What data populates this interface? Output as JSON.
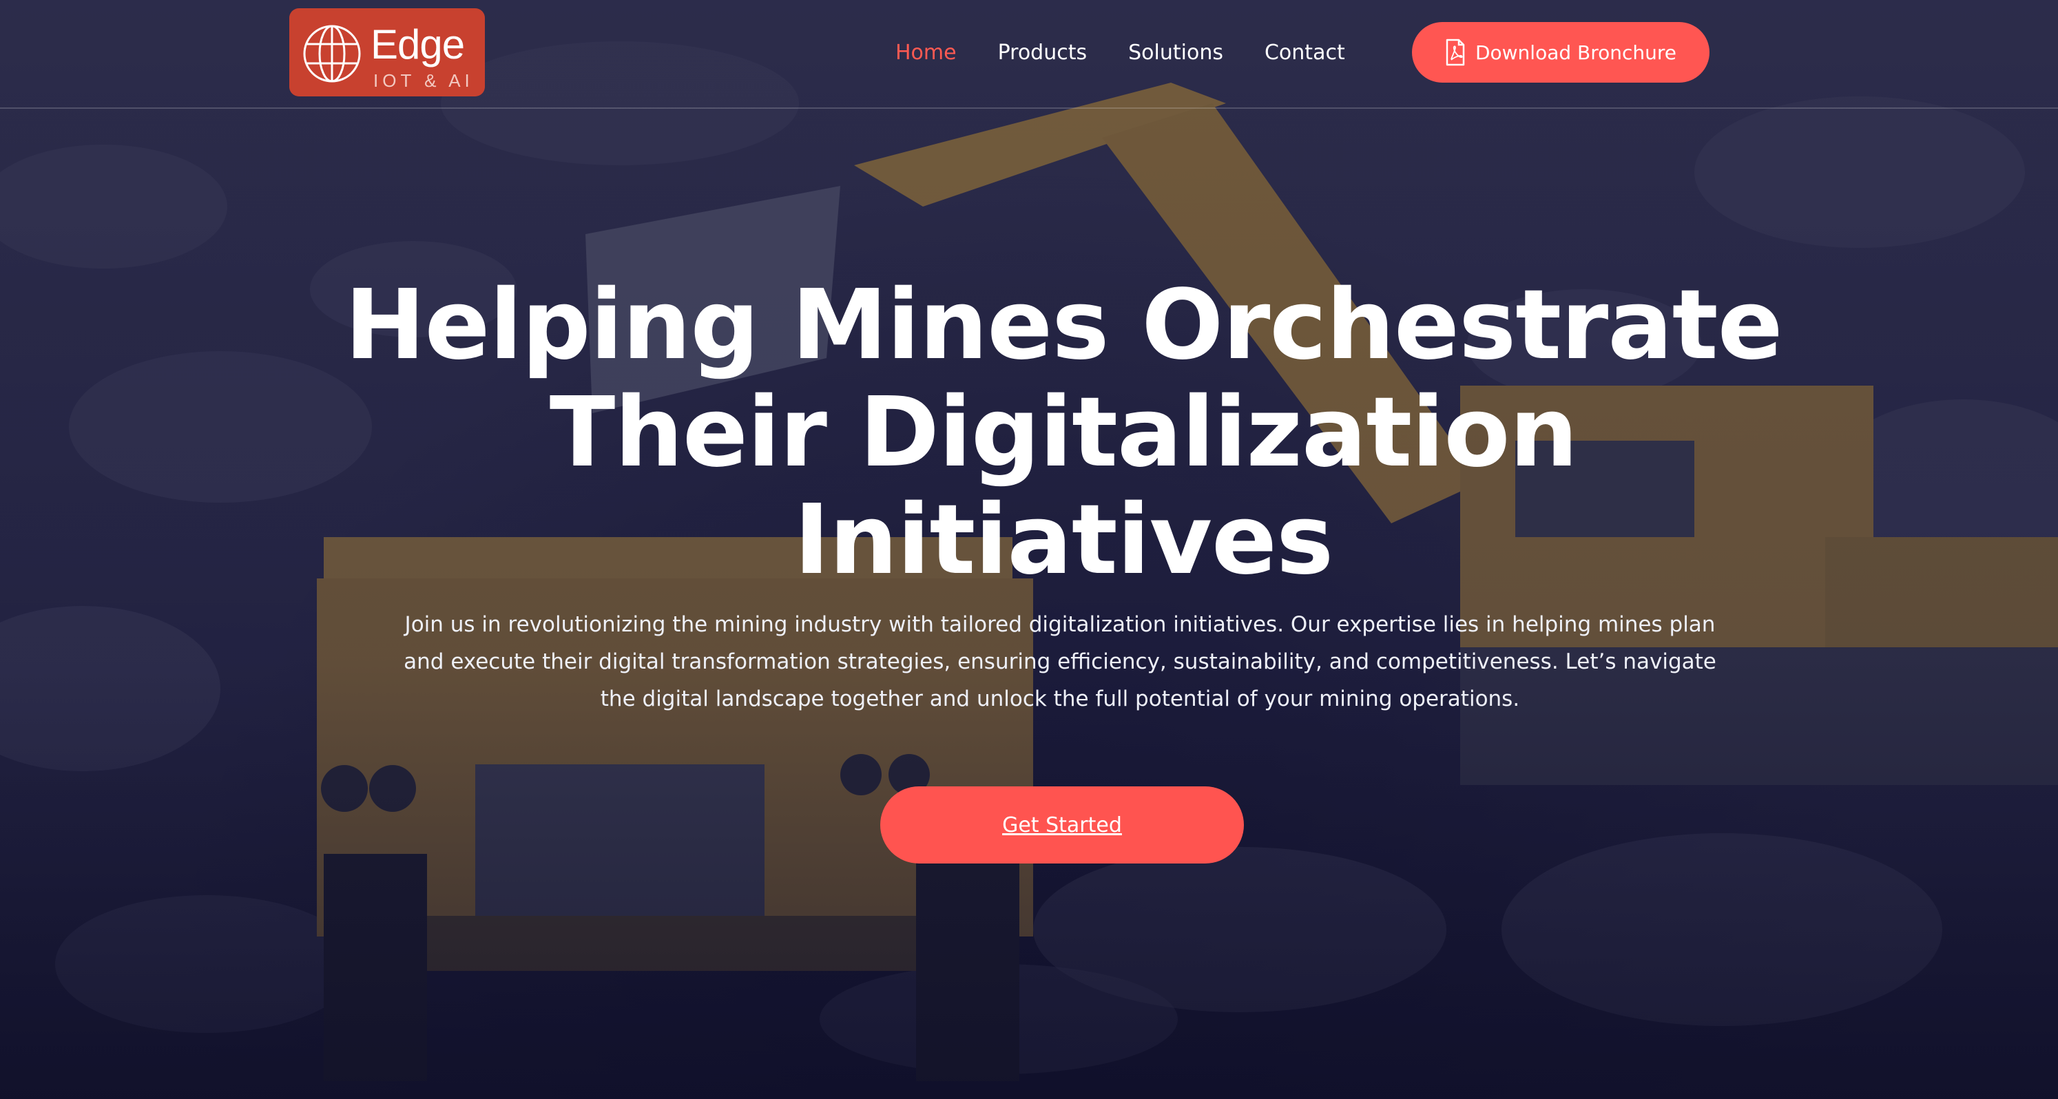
{
  "brand": {
    "name": "Edge",
    "tagline": "IOT & AI",
    "logo_icon": "globe-icon",
    "color": "#c8412f"
  },
  "nav": {
    "items": [
      {
        "label": "Home",
        "active": true
      },
      {
        "label": "Products",
        "active": false
      },
      {
        "label": "Solutions",
        "active": false
      },
      {
        "label": "Contact",
        "active": false
      }
    ],
    "active_color": "#ff5a52",
    "cta": {
      "label": "Download Bronchure",
      "icon": "pdf-file-icon"
    }
  },
  "hero": {
    "title_lines": [
      "Helping Mines Orchestrate",
      "Their Digitalization",
      "Initiatives"
    ],
    "description_lines": [
      "Join us in revolutionizing the mining industry with tailored digitalization initiatives. Our expertise lies in helping mines plan",
      "and execute their digital transformation strategies, ensuring efficiency, sustainability, and competitiveness. Let’s navigate",
      "the digital landscape together and unlock the full potential of your mining operations."
    ],
    "cta_label": "Get Started",
    "background": "mining-site-photo",
    "accent_color": "#ff5450"
  }
}
